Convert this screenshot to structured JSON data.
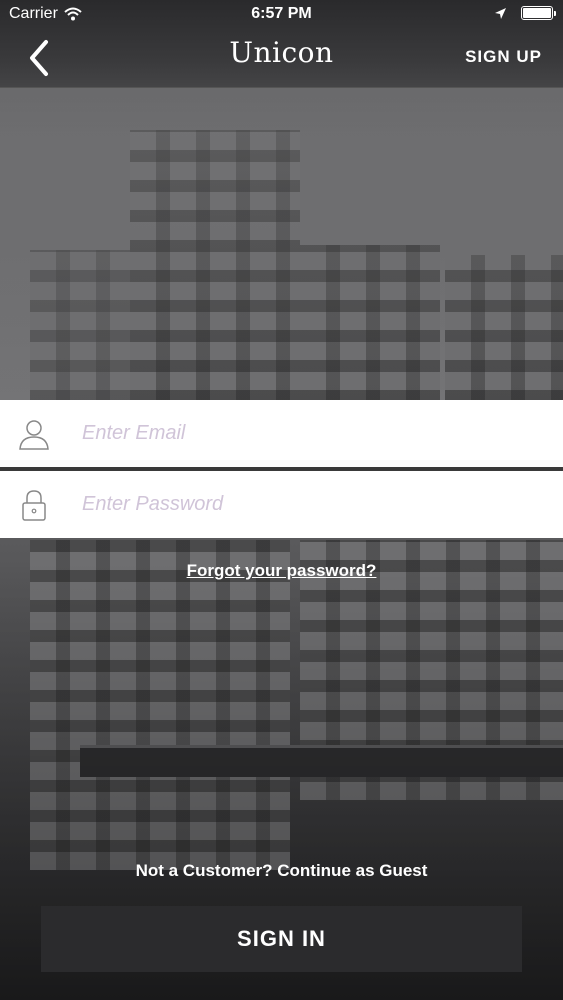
{
  "status_bar": {
    "carrier": "Carrier",
    "time": "6:57 PM",
    "icons": [
      "wifi-icon",
      "location-arrow-icon",
      "battery-icon"
    ]
  },
  "nav": {
    "back_icon": "chevron-left-icon",
    "title": "Unicon",
    "signup_label": "SIGN UP"
  },
  "form": {
    "email": {
      "icon": "user-icon",
      "placeholder": "Enter Email",
      "value": ""
    },
    "password": {
      "icon": "lock-icon",
      "placeholder": "Enter Password",
      "value": ""
    },
    "forgot_label": "Forgot your password?"
  },
  "footer": {
    "guest_label": "Not a Customer? Continue as Guest",
    "signin_label": "SIGN IN"
  },
  "colors": {
    "nav_bg": "#3a3a3c",
    "button_bg": "#2b2b2d",
    "placeholder": "#d0c4d8",
    "text": "#ffffff"
  }
}
